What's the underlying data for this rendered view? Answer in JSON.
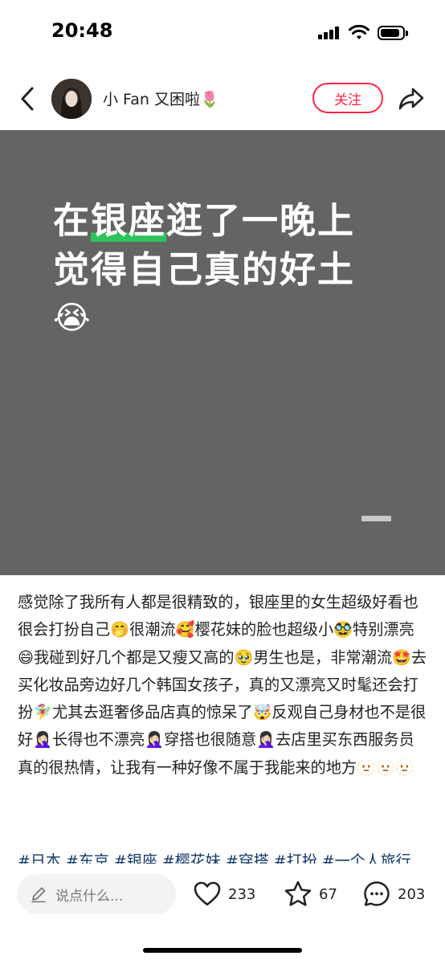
{
  "status_bar": {
    "time": "20:48"
  },
  "header": {
    "username": "小 Fan 又困啦🌷",
    "follow_label": "关注"
  },
  "banner": {
    "line1_pre": "在",
    "line1_hl": "银座",
    "line1_post": "逛了一晚上",
    "line2": "觉得自己真的好土",
    "line3": "😭"
  },
  "post": {
    "body": "感觉除了我所有人都是很精致的，银座里的女生超级好看也很会打扮自己🤭很潮流🥰樱花妹的脸也超级小🥸特别漂亮😄我碰到好几个都是又瘦又高的🥹男生也是，非常潮流🤩去买化妆品旁边好几个韩国女孩子，真的又漂亮又时髦还会打扮🧚‍♀️尤其去逛奢侈品店真的惊呆了🤯反观自己身材也不是很好🤦🏻‍♀️长得也不漂亮🤦🏻‍♀️穿搭也很随意🤦🏻‍♀️去店里买东西服务员真的很热情，让我有一种好像不属于我能来的地方🫥🫥🫥",
    "tags": "#日本 #东京 #银座 #樱花妹 #穿搭 #打扮 #一个人旅行"
  },
  "bottom_bar": {
    "comment_placeholder": "说点什么...",
    "likes": "233",
    "collects": "67",
    "comments": "203"
  }
}
